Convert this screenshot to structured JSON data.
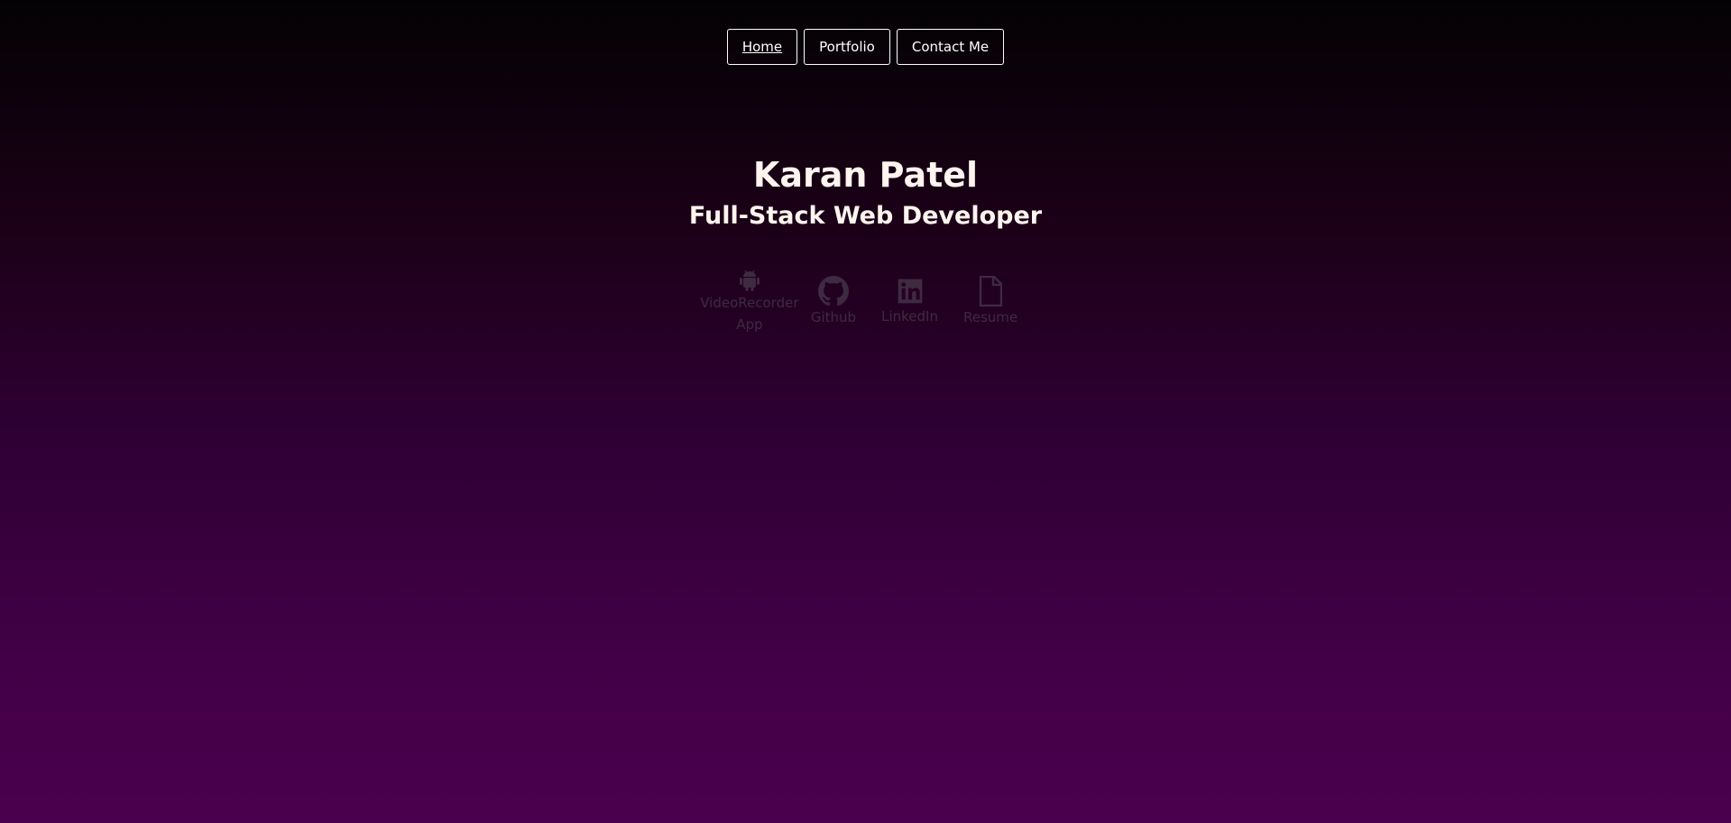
{
  "nav": {
    "home_label": "Home",
    "portfolio_label": "Portfolio",
    "contact_label": "Contact Me"
  },
  "hero": {
    "name": "Karan Patel",
    "role": "Full-Stack Web Developer"
  },
  "links": {
    "app": {
      "label_line1": "VideoRecorder",
      "label_line2": "App",
      "icon": "android-icon"
    },
    "github": {
      "label": "Github",
      "icon": "github-icon"
    },
    "linkedin": {
      "label": "LinkedIn",
      "icon": "linkedin-icon"
    },
    "resume": {
      "label": "Resume",
      "icon": "file-icon"
    }
  },
  "colors": {
    "text": "#ffffff",
    "muted_link": "#3e2a41",
    "gradient_top": "#030203",
    "gradient_bottom": "#4a004e"
  }
}
